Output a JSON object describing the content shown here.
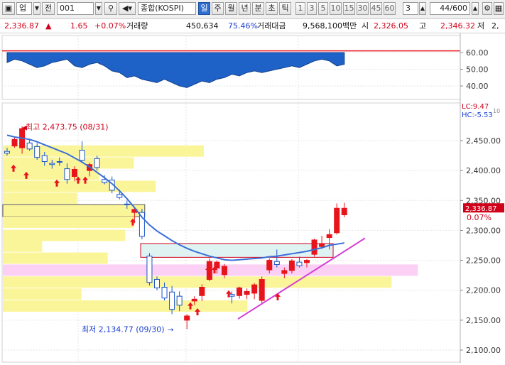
{
  "toolbar": {
    "market": "업",
    "market_button": "전",
    "code": "001",
    "name": "종합(KOSPI)",
    "periods": [
      "일",
      "주",
      "월",
      "년",
      "분",
      "초",
      "틱"
    ],
    "active_period": "일",
    "intervals": [
      "1",
      "3",
      "5",
      "10",
      "15",
      "30",
      "45",
      "60"
    ],
    "custom_interval": "3",
    "count": "44/600"
  },
  "quote": {
    "price": "2,336.87",
    "arrow": "▲",
    "change": "1.65",
    "change_pct": "+0.07%",
    "volume_label": "거래량",
    "volume": "450,634",
    "volume_ratio": "75.46%",
    "amount_label": "거래대금",
    "amount": "9,568,100백만",
    "open_label": "시",
    "open": "2,326.05",
    "high_label": "고",
    "high": "2,346.32",
    "low_label": "저",
    "low": "2,"
  },
  "upper_axis": [
    "60.00",
    "50.00",
    "40.00"
  ],
  "price_axis": [
    "2,450.00",
    "2,400.00",
    "2,350.00",
    "2,300.00",
    "2,250.00",
    "2,200.00",
    "2,150.00",
    "2,100.00"
  ],
  "lc_label": "LC:9.47",
  "hc_label": "HC:-5.53",
  "hc_extra": "10",
  "current_price_tag": "2,336.87",
  "current_pct_tag": "0.07%",
  "max_annotation": "최고 2,473.75 (08/31)",
  "min_annotation": "최저 2,134.77 (09/30)",
  "colors": {
    "up": "#e8141c",
    "down": "#1a55c9",
    "ma": "#3a6fd8",
    "trend": "#d43fd4",
    "volume_bar": "#fbf59a",
    "area": "#1e62c8"
  },
  "chart_data": {
    "type": "candlestick",
    "ylim": [
      2090,
      2490
    ],
    "candles": [
      {
        "o": 2432,
        "h": 2438,
        "l": 2425,
        "c": 2429
      },
      {
        "o": 2441,
        "h": 2455,
        "l": 2438,
        "c": 2452
      },
      {
        "o": 2438,
        "h": 2474,
        "l": 2428,
        "c": 2470
      },
      {
        "o": 2446,
        "h": 2452,
        "l": 2433,
        "c": 2436
      },
      {
        "o": 2440,
        "h": 2446,
        "l": 2418,
        "c": 2422
      },
      {
        "o": 2425,
        "h": 2431,
        "l": 2408,
        "c": 2415
      },
      {
        "o": 2412,
        "h": 2418,
        "l": 2403,
        "c": 2410
      },
      {
        "o": 2415,
        "h": 2422,
        "l": 2408,
        "c": 2414
      },
      {
        "o": 2403,
        "h": 2412,
        "l": 2378,
        "c": 2385
      },
      {
        "o": 2390,
        "h": 2407,
        "l": 2382,
        "c": 2402
      },
      {
        "o": 2434,
        "h": 2449,
        "l": 2414,
        "c": 2417
      },
      {
        "o": 2400,
        "h": 2413,
        "l": 2390,
        "c": 2410
      },
      {
        "o": 2420,
        "h": 2425,
        "l": 2400,
        "c": 2405
      },
      {
        "o": 2385,
        "h": 2392,
        "l": 2377,
        "c": 2380
      },
      {
        "o": 2384,
        "h": 2390,
        "l": 2362,
        "c": 2367
      },
      {
        "o": 2360,
        "h": 2368,
        "l": 2352,
        "c": 2355
      },
      {
        "o": 2344,
        "h": 2350,
        "l": 2336,
        "c": 2343
      },
      {
        "o": 2330,
        "h": 2339,
        "l": 2312,
        "c": 2335
      },
      {
        "o": 2330,
        "h": 2336,
        "l": 2285,
        "c": 2290
      },
      {
        "o": 2257,
        "h": 2262,
        "l": 2208,
        "c": 2213
      },
      {
        "o": 2218,
        "h": 2223,
        "l": 2200,
        "c": 2204
      },
      {
        "o": 2205,
        "h": 2213,
        "l": 2183,
        "c": 2187
      },
      {
        "o": 2197,
        "h": 2207,
        "l": 2160,
        "c": 2168
      },
      {
        "o": 2190,
        "h": 2198,
        "l": 2165,
        "c": 2175
      },
      {
        "o": 2150,
        "h": 2160,
        "l": 2135,
        "c": 2157
      },
      {
        "o": 2182,
        "h": 2190,
        "l": 2175,
        "c": 2185
      },
      {
        "o": 2191,
        "h": 2210,
        "l": 2182,
        "c": 2205
      },
      {
        "o": 2218,
        "h": 2253,
        "l": 2215,
        "c": 2248
      },
      {
        "o": 2237,
        "h": 2250,
        "l": 2228,
        "c": 2247
      },
      {
        "o": 2226,
        "h": 2244,
        "l": 2220,
        "c": 2240
      },
      {
        "o": 2193,
        "h": 2198,
        "l": 2178,
        "c": 2190
      },
      {
        "o": 2191,
        "h": 2206,
        "l": 2186,
        "c": 2204
      },
      {
        "o": 2193,
        "h": 2203,
        "l": 2185,
        "c": 2198
      },
      {
        "o": 2195,
        "h": 2212,
        "l": 2185,
        "c": 2209
      },
      {
        "o": 2183,
        "h": 2223,
        "l": 2178,
        "c": 2218
      },
      {
        "o": 2234,
        "h": 2253,
        "l": 2228,
        "c": 2250
      },
      {
        "o": 2248,
        "h": 2268,
        "l": 2238,
        "c": 2243
      },
      {
        "o": 2228,
        "h": 2238,
        "l": 2220,
        "c": 2233
      },
      {
        "o": 2233,
        "h": 2252,
        "l": 2228,
        "c": 2249
      },
      {
        "o": 2247,
        "h": 2256,
        "l": 2238,
        "c": 2241
      },
      {
        "o": 2246,
        "h": 2252,
        "l": 2238,
        "c": 2250
      },
      {
        "o": 2260,
        "h": 2286,
        "l": 2256,
        "c": 2284
      },
      {
        "o": 2273,
        "h": 2291,
        "l": 2269,
        "c": 2278
      },
      {
        "o": 2288,
        "h": 2302,
        "l": 2268,
        "c": 2293
      },
      {
        "o": 2296,
        "h": 2345,
        "l": 2293,
        "c": 2337
      },
      {
        "o": 2326,
        "h": 2346,
        "l": 2322,
        "c": 2337
      }
    ],
    "moving_average": [
      2459,
      2456,
      2454,
      2452,
      2448,
      2443,
      2438,
      2433,
      2428,
      2421,
      2414,
      2406,
      2397,
      2388,
      2378,
      2366,
      2353,
      2338,
      2322,
      2309,
      2299,
      2291,
      2283,
      2276,
      2270,
      2265,
      2261,
      2257,
      2254,
      2251,
      2250,
      2251,
      2252,
      2253,
      2254,
      2256,
      2257,
      2259,
      2261,
      2263,
      2265,
      2268,
      2271,
      2275,
      2277,
      2279
    ],
    "indicator": [
      54,
      56,
      55,
      53,
      51,
      52,
      54,
      55,
      56,
      52,
      51,
      53,
      54,
      52,
      49,
      48,
      45,
      46,
      44,
      43,
      42,
      44,
      42,
      40,
      39,
      41,
      43,
      42,
      44,
      45,
      47,
      46,
      48,
      49,
      48,
      49,
      50,
      51,
      52,
      51,
      53,
      55,
      56,
      55,
      52,
      53
    ],
    "indicator_ylim": [
      30,
      65
    ],
    "volume_profile": [
      {
        "price": 2432,
        "width": 0.46,
        "pinned": false
      },
      {
        "price": 2412,
        "width": 0.3,
        "pinned": false
      },
      {
        "price": 2393,
        "width": 0.22,
        "pinned": false
      },
      {
        "price": 2373,
        "width": 0.35,
        "pinned": false
      },
      {
        "price": 2353,
        "width": 0.17,
        "pinned": false
      },
      {
        "price": 2333,
        "width": 0.32,
        "pinned": true
      },
      {
        "price": 2313,
        "width": 0.3,
        "pinned": false
      },
      {
        "price": 2291,
        "width": 0.28,
        "pinned": false
      },
      {
        "price": 2273,
        "width": 0.09,
        "pinned": false
      },
      {
        "price": 2253,
        "width": 0.24,
        "pinned": false
      },
      {
        "price": 2233,
        "width": 0.95,
        "pinned": false,
        "pink": true
      },
      {
        "price": 2213,
        "width": 0.89,
        "pinned": false
      },
      {
        "price": 2193,
        "width": 0.18,
        "pinned": false
      },
      {
        "price": 2173,
        "width": 0.56,
        "pinned": false
      }
    ]
  }
}
